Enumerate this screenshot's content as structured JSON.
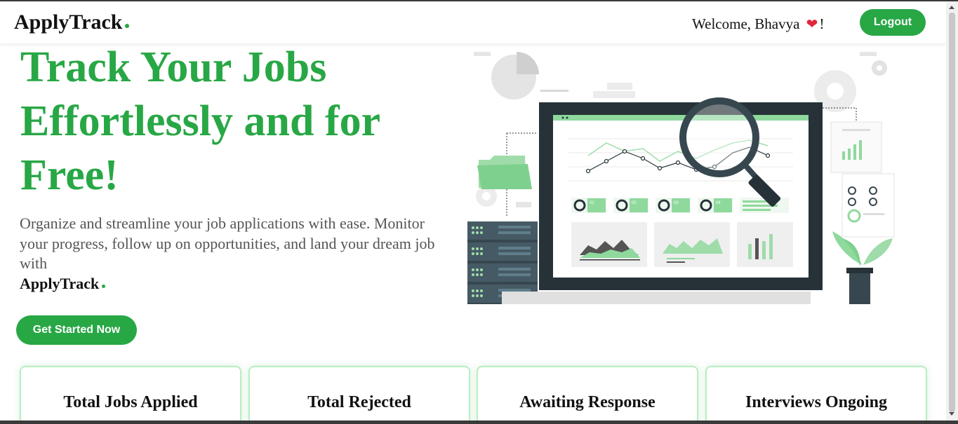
{
  "navbar": {
    "brand": "ApplyTrack",
    "welcome_text": "Welcome, Bhavya",
    "welcome_suffix": "!",
    "logout_label": "Logout"
  },
  "hero": {
    "title": "Track Your Jobs Effortlessly and for Free!",
    "description": "Organize and streamline your job applications with ease. Monitor your progress, follow up on opportunities, and land your dream job with",
    "brand": "ApplyTrack",
    "cta_label": "Get Started Now"
  },
  "illustration": {
    "cards": [
      "01",
      "02",
      "03",
      "04"
    ]
  },
  "stats": [
    {
      "title": "Total Jobs Applied"
    },
    {
      "title": "Total Rejected"
    },
    {
      "title": "Awaiting Response"
    },
    {
      "title": "Interviews Ongoing"
    }
  ],
  "colors": {
    "accent": "#28a745",
    "heart": "#e0263a",
    "card_border": "#b8eec2"
  },
  "icons": [
    "heart-icon",
    "brand-dot-icon"
  ]
}
